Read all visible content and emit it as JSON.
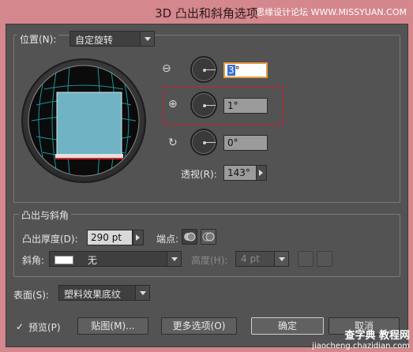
{
  "window": {
    "title": "3D 凸出和斜角选项",
    "watermark": "思缘设计论坛 WWW.MISSYUAN.COM"
  },
  "position": {
    "label": "位置(N):",
    "preset": "自定旋转",
    "x_rotation": "3°",
    "x_rotation_selected": "3",
    "y_rotation": "1°",
    "z_rotation": "0°",
    "perspective_label": "透视(R):",
    "perspective_value": "143°"
  },
  "extrude": {
    "group_label": "凸出与斜角",
    "depth_label": "凸出厚度(D):",
    "depth_value": "290 pt",
    "cap_label": "端点:",
    "bevel_label": "斜角:",
    "bevel_value": "无",
    "height_label": "高度(H):",
    "height_value": "4 pt"
  },
  "surface": {
    "label": "表面(S):",
    "value": "塑料效果底纹"
  },
  "footer": {
    "preview_check": "✓",
    "preview_label": "预览(P)",
    "map_button": "贴图(M)...",
    "more_options_button": "更多选项(O)",
    "ok_button": "确定",
    "cancel_button": "取消"
  },
  "watermark_bottom": {
    "line1": "查字典 教程网",
    "line2": "jiaocheng.chazidian.com"
  },
  "colors": {
    "background": "#d4878c",
    "dialog": "#535353",
    "highlight_box": "#c8232c",
    "cube_face": "#6fb3c4",
    "grid": "#1fa3b0"
  },
  "icons": {
    "x_axis": "x-rotation-icon",
    "y_axis": "y-rotation-icon",
    "z_axis": "z-rotation-icon"
  }
}
